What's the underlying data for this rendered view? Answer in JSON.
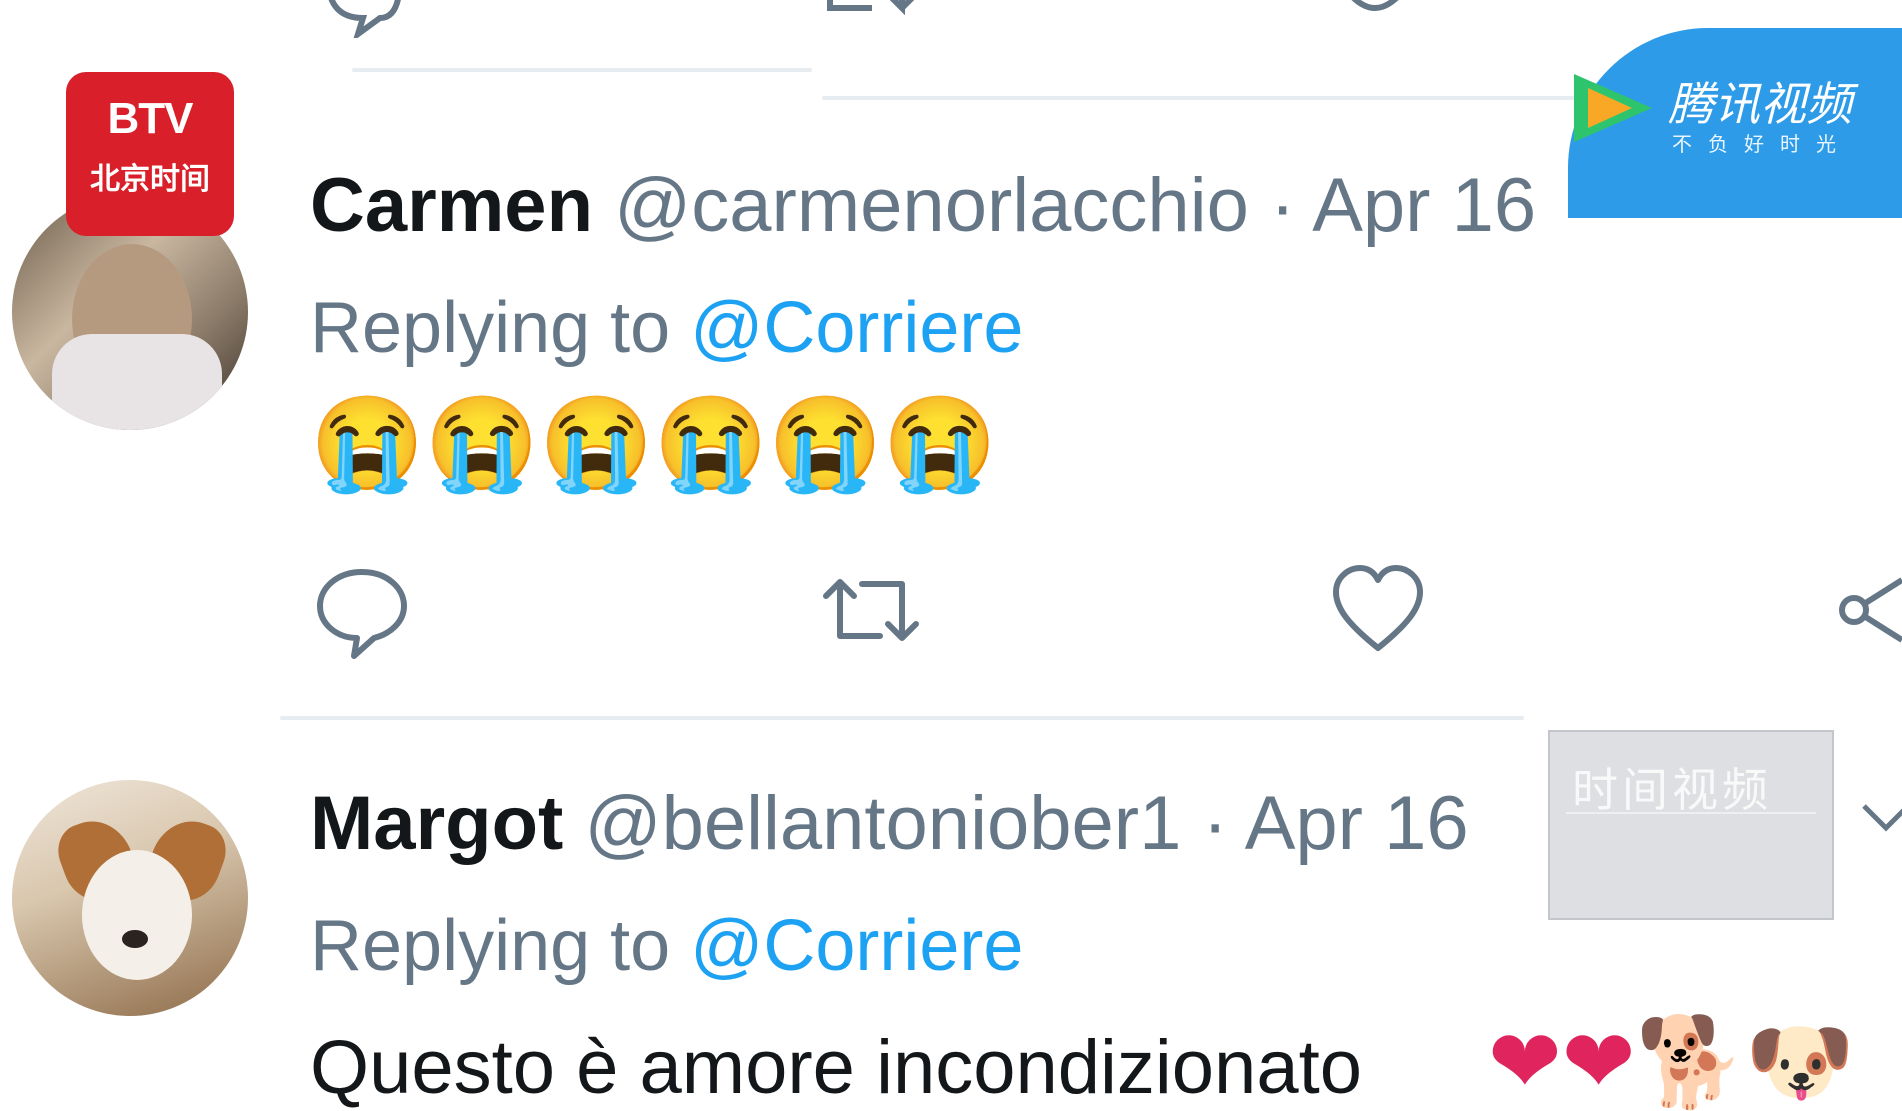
{
  "tweets": [
    {
      "name": "Carmen",
      "handle": "@carmenorlacchio",
      "separator": "·",
      "date": "Apr 16",
      "replying_prefix": "Replying to",
      "replying_to": "@Corriere",
      "content": "😭😭😭😭😭😭"
    },
    {
      "name": "Margot",
      "handle": "@bellantoniober1",
      "separator": "·",
      "date": "Apr 16",
      "replying_prefix": "Replying to",
      "replying_to": "@Corriere",
      "content": "Questo è amore incondizionato"
    }
  ],
  "icons": [
    "reply-icon",
    "retweet-icon",
    "like-icon",
    "share-icon",
    "chevron-down-icon"
  ],
  "watermarks": {
    "btv_logo": "BTV",
    "btv_sub": "北京时间",
    "tencent_title": "腾讯视频",
    "tencent_slogan": "不负好时光",
    "time_video": "时间视频"
  },
  "colors": {
    "accent": "#1da1f2",
    "muted": "#657786",
    "text": "#14171a",
    "btv_red": "#d9202a",
    "tencent_blue": "#2d9be8"
  }
}
